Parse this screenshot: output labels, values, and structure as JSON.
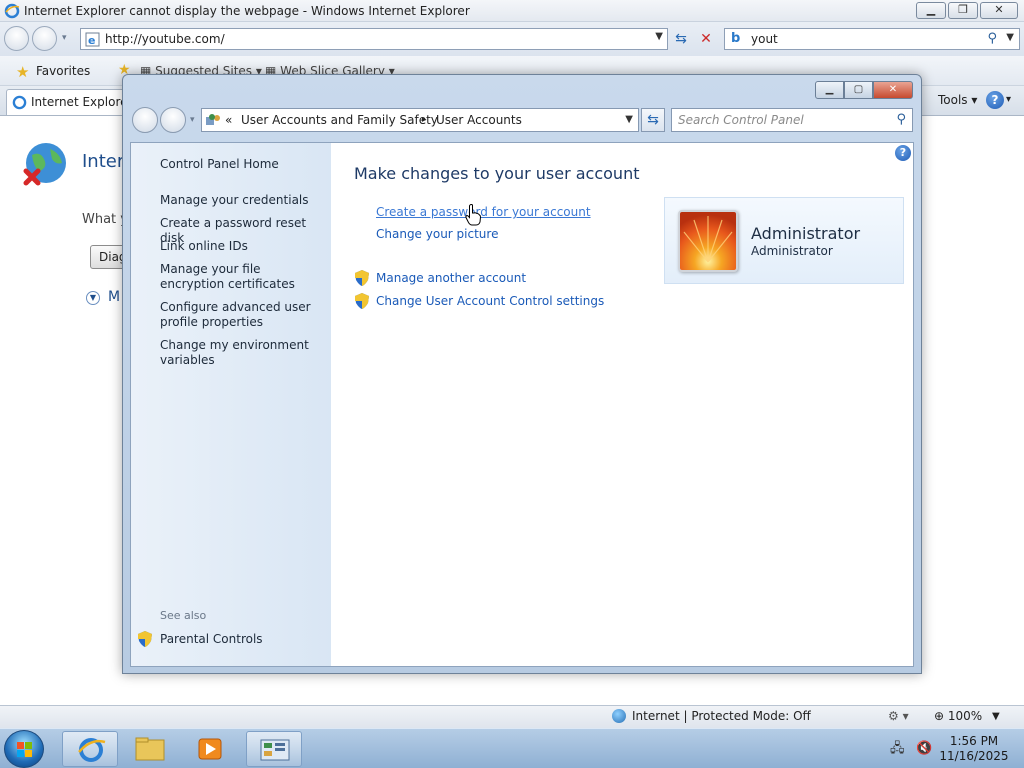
{
  "ie": {
    "title": "Internet Explorer cannot display the webpage - Windows Internet Explorer",
    "address": "http://youtube.com/",
    "search_value": "yout",
    "favorites_label": "Favorites",
    "fav_links": [
      "Suggested Sites",
      "Web Slice Gallery"
    ],
    "tab_title": "Internet Explorer c",
    "tools_label": "Tools",
    "page": {
      "error_title": "Intern",
      "question": "What y",
      "diag_button": "Diag",
      "more_info": "M"
    },
    "status": {
      "zone": "Internet | Protected Mode: Off",
      "zoom": "100%"
    }
  },
  "cp": {
    "breadcrumb": {
      "prefix": "«",
      "sep": "▸",
      "items": [
        "User Accounts and Family Safety",
        "User Accounts"
      ]
    },
    "search_placeholder": "Search Control Panel",
    "sidebar": {
      "home": "Control Panel Home",
      "links": [
        "Manage your credentials",
        "Create a password reset disk",
        "Link online IDs",
        "Manage your file encryption certificates",
        "Configure advanced user profile properties",
        "Change my environment variables"
      ],
      "see_also": "See also",
      "parental": "Parental Controls"
    },
    "main": {
      "title": "Make changes to your user account",
      "tasks": [
        "Create a password for your account",
        "Change your picture"
      ],
      "shield_tasks": [
        "Manage another account",
        "Change User Account Control settings"
      ]
    },
    "user": {
      "name": "Administrator",
      "role": "Administrator"
    }
  },
  "taskbar": {
    "time": "1:56 PM",
    "date": "11/16/2025"
  },
  "colors": {
    "link": "#1a5ab8",
    "title": "#1e3a66",
    "sidebar_bg": "#e3edf8"
  }
}
